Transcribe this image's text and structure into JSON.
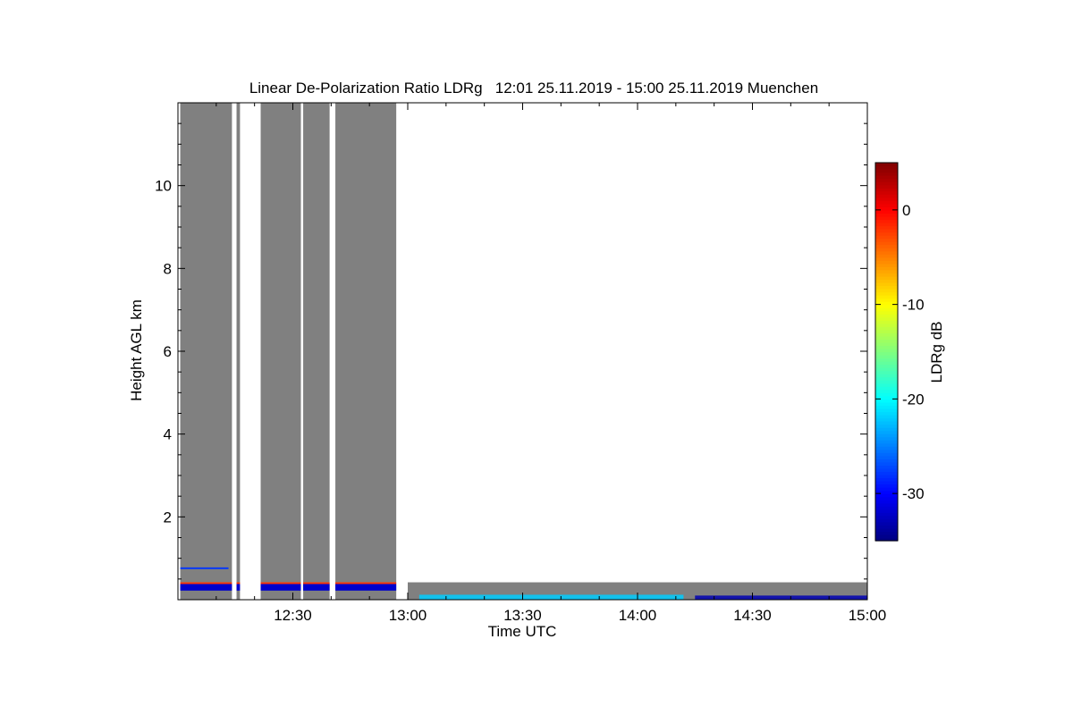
{
  "chart_data": {
    "type": "heatmap",
    "title": "Linear De-Polarization Ratio LDRg   12:01 25.11.2019 - 15:00 25.11.2019 Muenchen",
    "xlabel": "Time UTC",
    "ylabel": "Height AGL km",
    "x_range_hours": [
      12.01,
      15.0
    ],
    "ylim_km": [
      0,
      12
    ],
    "x_ticks": [
      {
        "value": 12.5,
        "label": "12:30"
      },
      {
        "value": 13.0,
        "label": "13:00"
      },
      {
        "value": 13.5,
        "label": "13:30"
      },
      {
        "value": 14.0,
        "label": "14:00"
      },
      {
        "value": 14.5,
        "label": "14:30"
      },
      {
        "value": 15.0,
        "label": "15:00"
      }
    ],
    "y_ticks": [
      {
        "value": 2,
        "label": "2"
      },
      {
        "value": 4,
        "label": "4"
      },
      {
        "value": 6,
        "label": "6"
      },
      {
        "value": 8,
        "label": "8"
      },
      {
        "value": 10,
        "label": "10"
      }
    ],
    "colorbar": {
      "label": "LDRg dB",
      "range_db": [
        -35,
        5
      ],
      "ticks": [
        {
          "value": 0,
          "label": "0"
        },
        {
          "value": -10,
          "label": "-10"
        },
        {
          "value": -20,
          "label": "-20"
        },
        {
          "value": -30,
          "label": "-30"
        }
      ],
      "colormap": "jet",
      "no_signal_color": "#808080"
    },
    "no_signal_periods_full_column": [
      {
        "start": 12.01,
        "end": 12.235
      },
      {
        "start": 12.255,
        "end": 12.27
      },
      {
        "start": 12.36,
        "end": 12.535
      },
      {
        "start": 12.545,
        "end": 12.66
      },
      {
        "start": 12.685,
        "end": 12.95
      }
    ],
    "low_layer_after_gap": {
      "start": 13.0,
      "end": 15.0,
      "top_km": 0.42
    },
    "features": [
      {
        "name": "low-level depolarization band",
        "time_start": 12.01,
        "time_end": 12.95,
        "height_km": [
          0.22,
          0.38
        ],
        "ldr_db": -32
      },
      {
        "name": "upper red layer",
        "time_start": 12.01,
        "time_end": 12.95,
        "height_km": [
          0.38,
          0.42
        ],
        "ldr_db": -2
      },
      {
        "name": "thin blue layer",
        "time_start": 12.01,
        "time_end": 12.22,
        "height_km": [
          0.74,
          0.78
        ],
        "ldr_db": -28
      },
      {
        "name": "surface layer 14:30-15:00",
        "time_start": 14.25,
        "time_end": 15.0,
        "height_km": [
          0.0,
          0.1
        ],
        "ldr_db": -33
      },
      {
        "name": "surface layer 13:00-14:15",
        "time_start": 13.05,
        "time_end": 14.2,
        "height_km": [
          0.0,
          0.12
        ],
        "ldr_db": -22
      }
    ]
  }
}
